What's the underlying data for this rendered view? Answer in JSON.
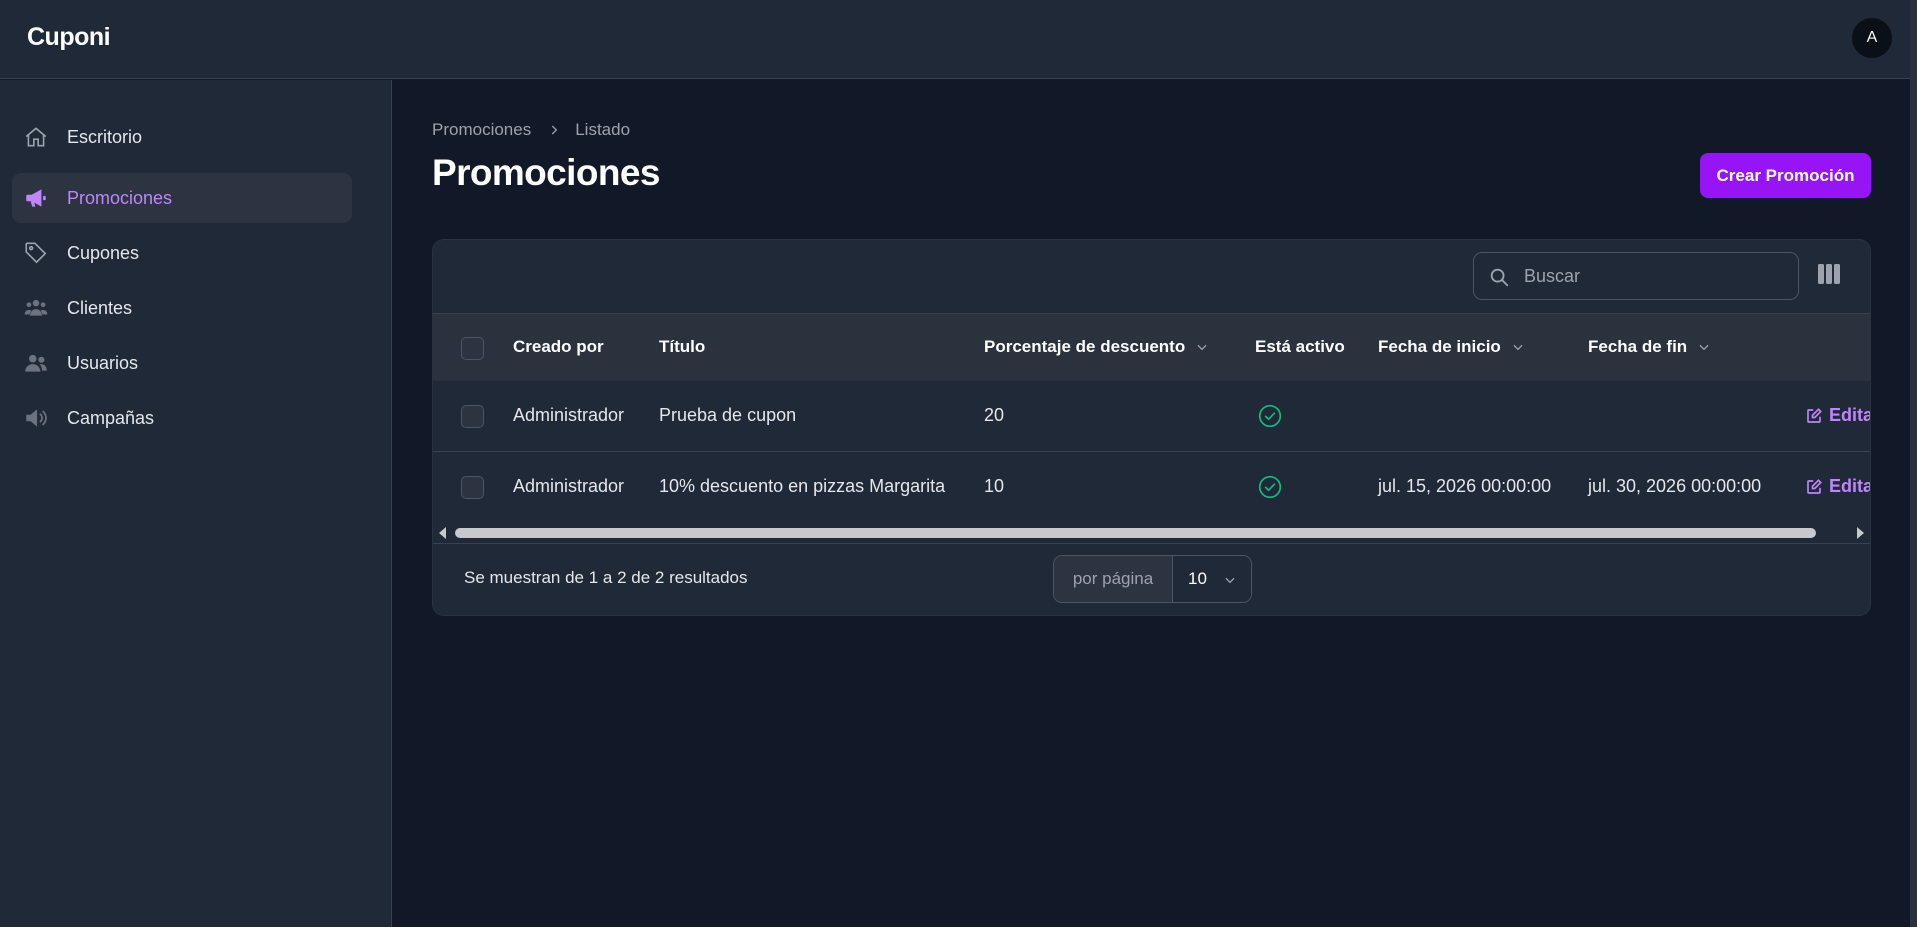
{
  "app": {
    "brand": "Cuponi",
    "user_initial": "A"
  },
  "sidebar": {
    "items": [
      {
        "label": "Escritorio",
        "icon": "home-icon",
        "active": false
      },
      {
        "label": "Promociones",
        "icon": "megaphone-icon",
        "active": true
      },
      {
        "label": "Cupones",
        "icon": "tag-icon",
        "active": false
      },
      {
        "label": "Clientes",
        "icon": "user-group-icon",
        "active": false
      },
      {
        "label": "Usuarios",
        "icon": "users-icon",
        "active": false
      },
      {
        "label": "Campañas",
        "icon": "speaker-icon",
        "active": false
      }
    ]
  },
  "header": {
    "breadcrumb": [
      "Promociones",
      "Listado"
    ],
    "title": "Promociones",
    "create_button": "Crear Promoción"
  },
  "table": {
    "search_placeholder": "Buscar",
    "columns": [
      "Creado por",
      "Título",
      "Porcentaje de descuento",
      "Está activo",
      "Fecha de inicio",
      "Fecha de fin"
    ],
    "rows": [
      {
        "created_by": "Administrador",
        "title": "Prueba de cupon",
        "discount": "20",
        "active": true,
        "start": "",
        "end": "",
        "action": "Editar"
      },
      {
        "created_by": "Administrador",
        "title": "10% descuento en pizzas Margarita",
        "discount": "10",
        "active": true,
        "start": "jul. 15, 2026 00:00:00",
        "end": "jul. 30, 2026 00:00:00",
        "action": "Editar"
      }
    ]
  },
  "footer": {
    "results_text": "Se muestran de 1 a 2 de 2 resultados",
    "per_page_label": "por página",
    "per_page_value": "10"
  },
  "colors": {
    "accent": "#9614f5",
    "accent_text": "#c084fc",
    "success": "#10b981"
  }
}
